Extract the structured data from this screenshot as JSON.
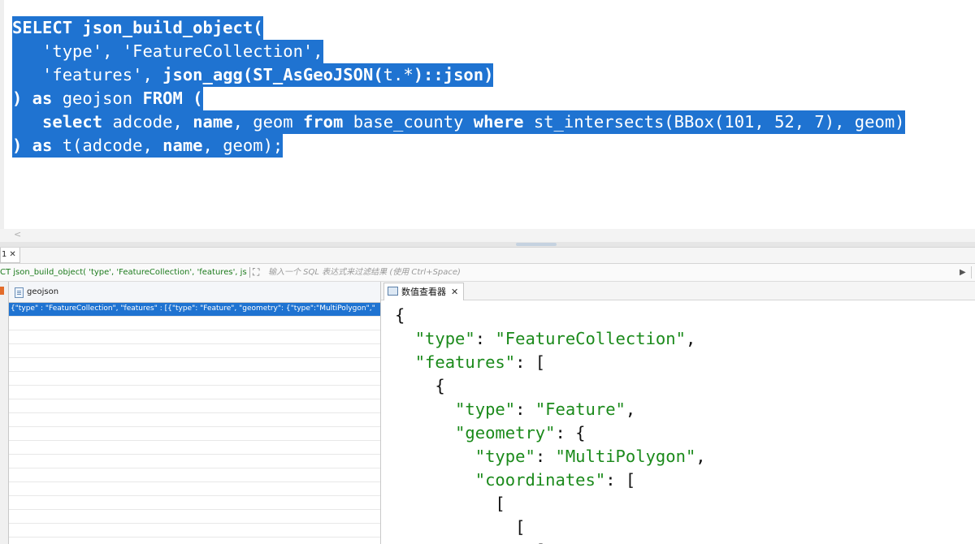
{
  "editor": {
    "lines": [
      [
        {
          "t": "SELECT json_build_object(",
          "kw": true
        }
      ],
      [
        {
          "t": "   'type', 'FeatureCollection',",
          "kw": false
        }
      ],
      [
        {
          "t": "   'features', ",
          "kw": false
        },
        {
          "t": "json_agg(ST_AsGeoJSON(",
          "kw": true
        },
        {
          "t": "t.*",
          "kw": false
        },
        {
          "t": ")::json)",
          "kw": true
        }
      ],
      [
        {
          "t": ") as ",
          "kw": true
        },
        {
          "t": "geojson ",
          "kw": false
        },
        {
          "t": "FROM (",
          "kw": true
        }
      ],
      [
        {
          "t": "   ",
          "kw": false
        },
        {
          "t": "select ",
          "kw": true
        },
        {
          "t": "adcode, ",
          "kw": false
        },
        {
          "t": "name",
          "kw": true
        },
        {
          "t": ", geom ",
          "kw": false
        },
        {
          "t": "from ",
          "kw": true
        },
        {
          "t": "base_county ",
          "kw": false
        },
        {
          "t": "where ",
          "kw": true
        },
        {
          "t": "st_intersects(BBox(101, 52, 7), geom)",
          "kw": false
        }
      ],
      [
        {
          "t": ") as ",
          "kw": true
        },
        {
          "t": "t(adcode, ",
          "kw": false
        },
        {
          "t": "name",
          "kw": true
        },
        {
          "t": ", geom);",
          "kw": false
        }
      ]
    ],
    "scroll_arrow": "<",
    "accent_selection": "#1f73d1"
  },
  "result_tab": {
    "label": "1",
    "close": "✕"
  },
  "filter": {
    "query_preview": "CT json_build_object( 'type', 'FeatureCollection', 'features', js",
    "expand_icon": "⛶",
    "hint": "输入一个 SQL 表达式来过滤结果 (使用 Ctrl+Space)",
    "run_icon": "▶"
  },
  "grid": {
    "column": "geojson",
    "rows": [
      "{\"type\" : \"FeatureCollection\", \"features\" : [{\"type\": \"Feature\", \"geometry\": {\"type\":\"MultiPolygon\",\"",
      "",
      "",
      "",
      "",
      "",
      "",
      "",
      "",
      "",
      "",
      "",
      "",
      "",
      "",
      "",
      "",
      ""
    ]
  },
  "viewer": {
    "tab_label": "数值查看器",
    "tab_close": "✕",
    "json_lines": [
      [
        {
          "c": "p",
          "t": "{"
        }
      ],
      [
        {
          "c": "p",
          "t": "  "
        },
        {
          "c": "k",
          "t": "\"type\""
        },
        {
          "c": "p",
          "t": ": "
        },
        {
          "c": "s",
          "t": "\"FeatureCollection\""
        },
        {
          "c": "p",
          "t": ","
        }
      ],
      [
        {
          "c": "p",
          "t": "  "
        },
        {
          "c": "k",
          "t": "\"features\""
        },
        {
          "c": "p",
          "t": ": ["
        }
      ],
      [
        {
          "c": "p",
          "t": "    {"
        }
      ],
      [
        {
          "c": "p",
          "t": "      "
        },
        {
          "c": "k",
          "t": "\"type\""
        },
        {
          "c": "p",
          "t": ": "
        },
        {
          "c": "s",
          "t": "\"Feature\""
        },
        {
          "c": "p",
          "t": ","
        }
      ],
      [
        {
          "c": "p",
          "t": "      "
        },
        {
          "c": "k",
          "t": "\"geometry\""
        },
        {
          "c": "p",
          "t": ": {"
        }
      ],
      [
        {
          "c": "p",
          "t": "        "
        },
        {
          "c": "k",
          "t": "\"type\""
        },
        {
          "c": "p",
          "t": ": "
        },
        {
          "c": "s",
          "t": "\"MultiPolygon\""
        },
        {
          "c": "p",
          "t": ","
        }
      ],
      [
        {
          "c": "p",
          "t": "        "
        },
        {
          "c": "k",
          "t": "\"coordinates\""
        },
        {
          "c": "p",
          "t": ": ["
        }
      ],
      [
        {
          "c": "p",
          "t": "          ["
        }
      ],
      [
        {
          "c": "p",
          "t": "            ["
        }
      ],
      [
        {
          "c": "p",
          "t": "              ["
        }
      ]
    ]
  }
}
